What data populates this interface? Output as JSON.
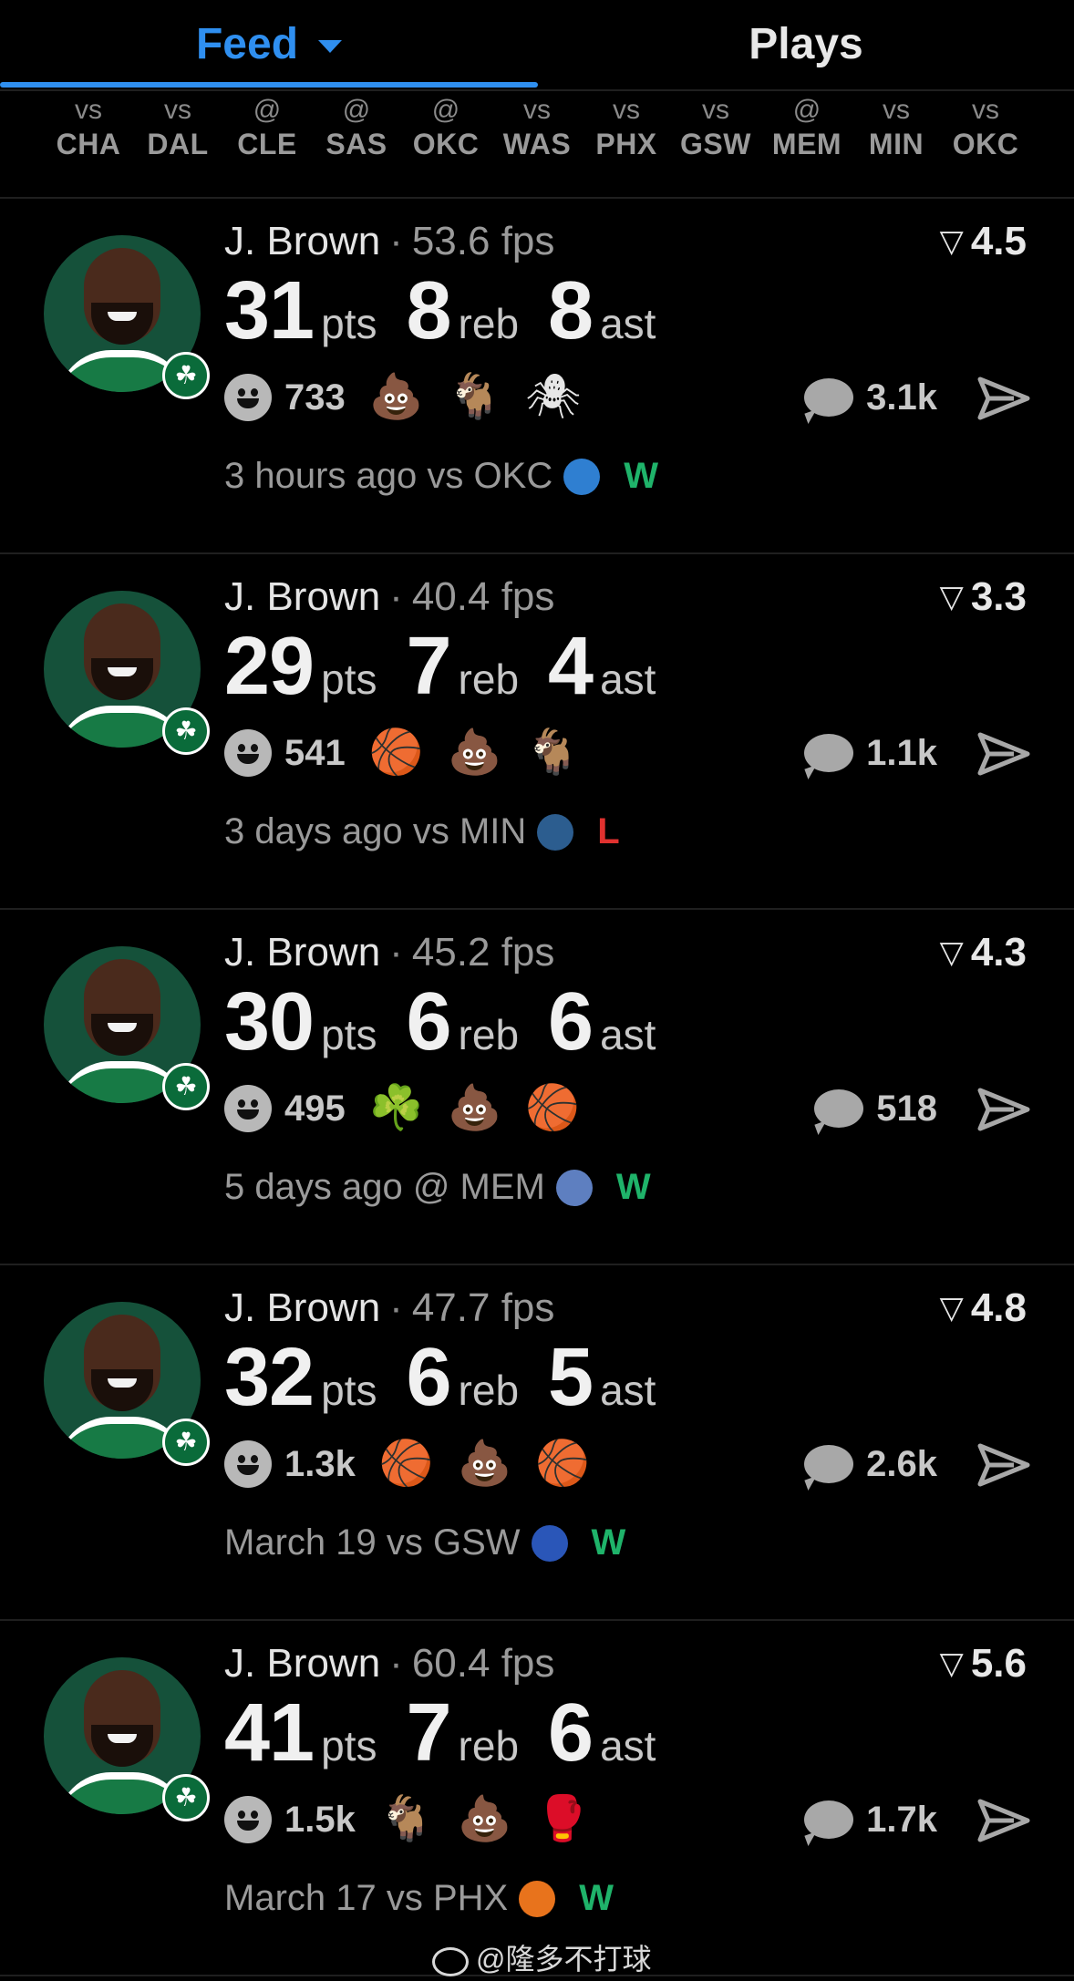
{
  "tabs": [
    {
      "label": "Feed",
      "active": true
    },
    {
      "label": "Plays",
      "active": false
    }
  ],
  "schedule": [
    {
      "pre": "vs",
      "team": "CHA"
    },
    {
      "pre": "vs",
      "team": "DAL"
    },
    {
      "pre": "@",
      "team": "CLE"
    },
    {
      "pre": "@",
      "team": "SAS"
    },
    {
      "pre": "@",
      "team": "OKC"
    },
    {
      "pre": "vs",
      "team": "WAS"
    },
    {
      "pre": "vs",
      "team": "PHX"
    },
    {
      "pre": "vs",
      "team": "GSW"
    },
    {
      "pre": "@",
      "team": "MEM"
    },
    {
      "pre": "vs",
      "team": "MIN"
    },
    {
      "pre": "vs",
      "team": "OKC"
    }
  ],
  "cards": [
    {
      "player": "J. Brown",
      "fps": "53.6 fps",
      "rating": "4.5",
      "pts": "31",
      "reb": "8",
      "ast": "8",
      "pts_label": "pts",
      "reb_label": "reb",
      "ast_label": "ast",
      "reactions": "733",
      "emojis": [
        "💩",
        "🐐",
        "🕷"
      ],
      "comments": "3.1k",
      "when": "3 hours ago",
      "opp": "vs OKC",
      "logo_color": "#2f7fd1",
      "result": "W",
      "result_color": "#1fb36a"
    },
    {
      "player": "J. Brown",
      "fps": "40.4 fps",
      "rating": "3.3",
      "pts": "29",
      "reb": "7",
      "ast": "4",
      "pts_label": "pts",
      "reb_label": "reb",
      "ast_label": "ast",
      "reactions": "541",
      "emojis": [
        "🏀",
        "💩",
        "🐐"
      ],
      "comments": "1.1k",
      "when": "3 days ago",
      "opp": "vs MIN",
      "logo_color": "#2c5d8f",
      "result": "L",
      "result_color": "#e0312f"
    },
    {
      "player": "J. Brown",
      "fps": "45.2 fps",
      "rating": "4.3",
      "pts": "30",
      "reb": "6",
      "ast": "6",
      "pts_label": "pts",
      "reb_label": "reb",
      "ast_label": "ast",
      "reactions": "495",
      "emojis": [
        "☘️",
        "💩",
        "🏀"
      ],
      "comments": "518",
      "when": "5 days ago",
      "opp": "@ MEM",
      "logo_color": "#5e7fc0",
      "result": "W",
      "result_color": "#1fb36a"
    },
    {
      "player": "J. Brown",
      "fps": "47.7 fps",
      "rating": "4.8",
      "pts": "32",
      "reb": "6",
      "ast": "5",
      "pts_label": "pts",
      "reb_label": "reb",
      "ast_label": "ast",
      "reactions": "1.3k",
      "emojis": [
        "🏀",
        "💩",
        "🏀"
      ],
      "comments": "2.6k",
      "when": "March 19",
      "opp": "vs GSW",
      "logo_color": "#2a56b8",
      "result": "W",
      "result_color": "#1fb36a"
    },
    {
      "player": "J. Brown",
      "fps": "60.4 fps",
      "rating": "5.6",
      "pts": "41",
      "reb": "7",
      "ast": "6",
      "pts_label": "pts",
      "reb_label": "reb",
      "ast_label": "ast",
      "reactions": "1.5k",
      "emojis": [
        "🐐",
        "💩",
        "🥊"
      ],
      "comments": "1.7k",
      "when": "March 17",
      "opp": "vs PHX",
      "logo_color": "#e8731c",
      "result": "W",
      "result_color": "#1fb36a"
    }
  ],
  "watermark": "@隆多不打球",
  "colors": {
    "accent": "#2f8ff0",
    "background": "#000000",
    "win": "#1fb36a",
    "loss": "#e0312f"
  }
}
